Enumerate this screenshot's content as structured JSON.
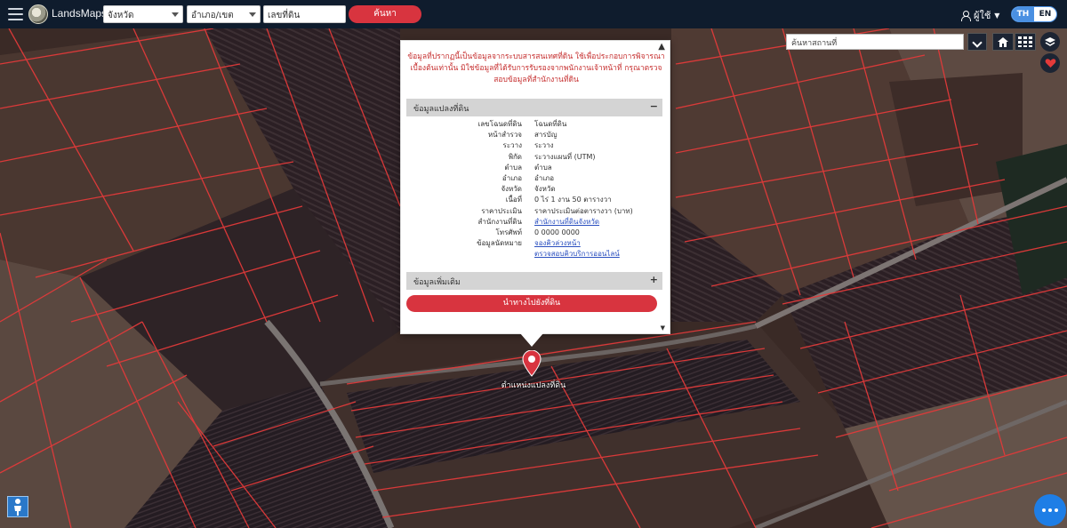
{
  "topbar": {
    "brand": "LandsMaps",
    "province_select": "จังหวัด",
    "district_select": "อำเภอ/เขต",
    "parcel_input": "เลขที่ดิน",
    "search_label": "ค้นหา",
    "user_label": "ผู้ใช้",
    "lang_th": "TH",
    "lang_en": "EN"
  },
  "map_controls": {
    "search_placeholder": "ค้นหาสถานที่",
    "home_icon": "home-icon",
    "grid_icon": "grid-icon",
    "layers_icon": "layers-icon",
    "favorite_icon": "heart-icon"
  },
  "popup": {
    "warning": "ข้อมูลที่ปรากฏนี้เป็นข้อมูลจากระบบสารสนเทศที่ดิน ใช้เพื่อประกอบการพิจารณาเบื้องต้นเท่านั้น มิใช่ข้อมูลที่ได้รับการรับรองจากพนักงานเจ้าหน้าที่ กรุณาตรวจสอบข้อมูลที่สำนักงานที่ดิน",
    "section_title": "ข้อมูลแปลงที่ดิน",
    "section_sign": "−",
    "rows": [
      {
        "k": "เลขโฉนดที่ดิน",
        "v": "โฉนดที่ดิน"
      },
      {
        "k": "หน้าสำรวจ",
        "v": "สารบัญ"
      },
      {
        "k": "ระวาง",
        "v": "ระวาง"
      },
      {
        "k": "พิกัด",
        "v": "ระวางแผนที่ (UTM)"
      },
      {
        "k": "ตำบล",
        "v": "ตำบล"
      },
      {
        "k": "อำเภอ",
        "v": "อำเภอ"
      },
      {
        "k": "จังหวัด",
        "v": "จังหวัด"
      },
      {
        "k": "เนื้อที่",
        "v": "0 ไร่ 1 งาน 50 ตารางวา"
      },
      {
        "k": "ราคาประเมิน",
        "v": "ราคาประเมินต่อตารางวา (บาท)"
      },
      {
        "k": "สำนักงานที่ดิน",
        "v": "สำนักงานที่ดินจังหวัด",
        "link": true
      },
      {
        "k": "โทรศัพท์",
        "v": "0 0000 0000"
      },
      {
        "k": "ข้อมูลนัดหมาย",
        "v": "จองคิวล่วงหน้า",
        "link": true
      },
      {
        "k": "",
        "v": "ตรวจสอบคิวบริการออนไลน์",
        "link": true
      }
    ],
    "section2_title": "ข้อมูลเพิ่มเติม",
    "section2_sign": "+",
    "action_label": "นำทางไปยังที่ดิน"
  },
  "marker": {
    "label": "ตำแหน่งแปลงที่ดิน"
  }
}
